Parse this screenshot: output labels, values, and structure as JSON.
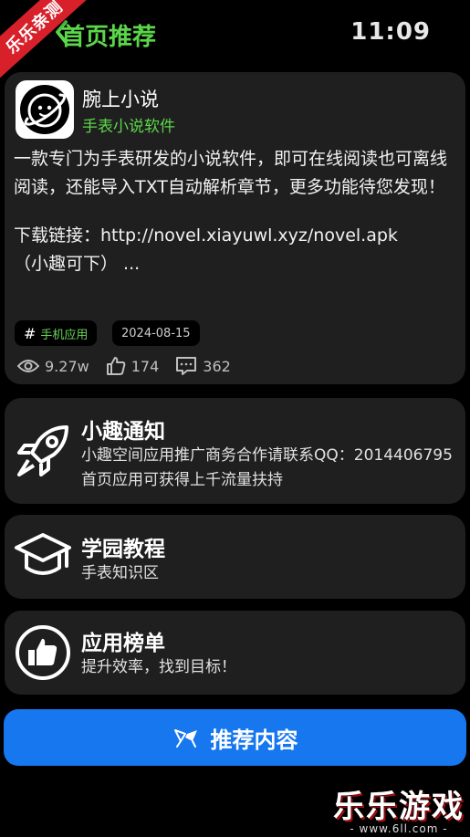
{
  "header": {
    "title": "首页推荐",
    "time": "11:09",
    "ribbon_text": "乐乐亲测"
  },
  "app": {
    "name": "腕上小说",
    "subtitle": "手表小说软件",
    "description": "一款专门为手表研发的小说软件，即可在线阅读也可离线阅读，还能导入TXT自动解析章节，更多功能待您发现！",
    "download": "下载链接：http://novel.xiayuwl.xyz/novel.apk",
    "download_note": "（小趣可下） ...",
    "tag_category": "手机应用",
    "tag_date": "2024-08-15",
    "views": "9.27w",
    "likes": "174",
    "comments": "362"
  },
  "notice": {
    "title": "小趣通知",
    "text": "小趣空间应用推广商务合作请联系QQ：2014406795 首页应用可获得上千流量扶持",
    "icon": "rocket-icon"
  },
  "tutorial": {
    "title": "学园教程",
    "text": "手表知识区",
    "icon": "graduation-cap-icon"
  },
  "ranking": {
    "title": "应用榜单",
    "text": "提升效率，找到目标！",
    "icon": "thumbs-up-icon"
  },
  "recommend_button": {
    "label": "推荐内容",
    "icon": "flags-icon"
  },
  "watermark": {
    "text": "乐乐游戏",
    "url": "- www.6ll.com -"
  },
  "colors": {
    "accent_green": "#5bd64a",
    "button_blue": "#1677ee",
    "card_bg": "#1f1f1f",
    "ribbon_red": "#d8202b"
  }
}
